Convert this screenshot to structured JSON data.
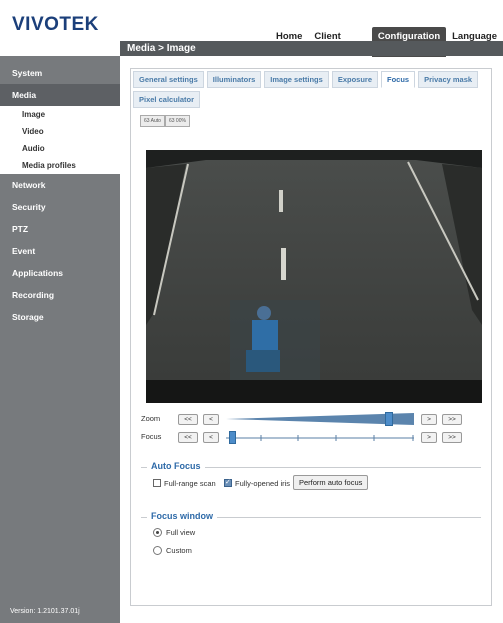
{
  "brand": "VIVOTEK",
  "topnav": [
    "Home",
    "Client settings",
    "Configuration",
    "Language"
  ],
  "topnav_active": "Configuration",
  "breadcrumb": "Media  > Image",
  "sidebar": {
    "items": [
      {
        "label": "System"
      },
      {
        "label": "Media"
      },
      {
        "label": "Network"
      },
      {
        "label": "Security"
      },
      {
        "label": "PTZ"
      },
      {
        "label": "Event"
      },
      {
        "label": "Applications"
      },
      {
        "label": "Recording"
      },
      {
        "label": "Storage"
      }
    ],
    "media_sub": [
      "Image",
      "Video",
      "Audio",
      "Media profiles"
    ],
    "version": "Version: 1.2101.37.01j"
  },
  "tabs": [
    "General settings",
    "Illuminators",
    "Image settings",
    "Exposure",
    "Focus",
    "Privacy mask",
    "Pixel calculator"
  ],
  "tab_active": "Focus",
  "mini_buttons": [
    "63 Auto",
    "63 00%"
  ],
  "zoom": {
    "label": "Zoom",
    "buttons": [
      "<<",
      "<",
      ">",
      ">>"
    ],
    "level": 0.88
  },
  "focus": {
    "label": "Focus",
    "buttons": [
      "<<",
      "<",
      ">",
      ">>"
    ],
    "level": 0.02
  },
  "auto_focus": {
    "title": "Auto Focus",
    "full_range_label": "Full-range scan",
    "full_range_checked": false,
    "iris_label": "Fully-opened iris",
    "iris_checked": true,
    "perform_label": "Perform auto focus"
  },
  "focus_window": {
    "title": "Focus window",
    "options": [
      "Full view",
      "Custom"
    ],
    "selected": "Full view"
  },
  "colors": {
    "accent": "#2e6aa8",
    "sidebar": "#777a7d",
    "titlebar": "#55595c"
  }
}
